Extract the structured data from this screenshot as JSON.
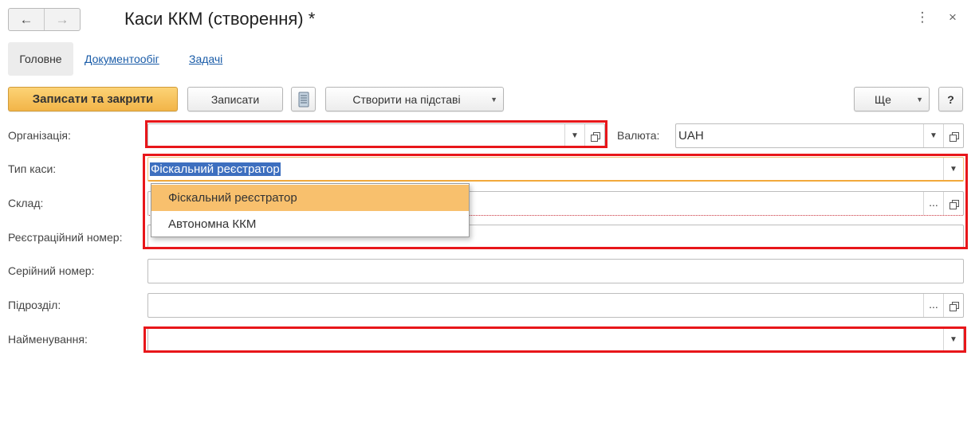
{
  "window": {
    "title": "Каси ККМ (створення) *",
    "back_icon": "←",
    "forward_icon": "→",
    "more_icon": "⋮",
    "close_icon": "×"
  },
  "tabs": [
    {
      "label": "Головне",
      "active": true
    },
    {
      "label": "Документообіг",
      "active": false
    },
    {
      "label": "Задачі",
      "active": false
    }
  ],
  "toolbar": {
    "save_close_label": "Записати та закрити",
    "save_label": "Записати",
    "create_based_label": "Створити на підставі",
    "more_label": "Ще",
    "help_label": "?"
  },
  "form": {
    "organization": {
      "label": "Організація:",
      "value": ""
    },
    "currency": {
      "label": "Валюта:",
      "value": "UAH"
    },
    "cash_type": {
      "label": "Тип каси:",
      "value": "Фіскальний реєстратор"
    },
    "warehouse": {
      "label": "Склад:",
      "value": ""
    },
    "reg_number": {
      "label": "Реєстраційний номер:",
      "value": ""
    },
    "serial_number": {
      "label": "Серійний номер:",
      "value": ""
    },
    "department": {
      "label": "Підрозділ:",
      "value": ""
    },
    "name": {
      "label": "Найменування:",
      "value": ""
    }
  },
  "dropdown": {
    "options": [
      "Фіскальний реєстратор",
      "Автономна ККМ"
    ],
    "highlighted_index": 0
  },
  "colors": {
    "primary_button": "#f2b448",
    "dropdown_highlight": "#f8c06d",
    "annotation_red": "#e8161a",
    "link": "#1a5ca8",
    "selection": "#3d6fbf"
  }
}
